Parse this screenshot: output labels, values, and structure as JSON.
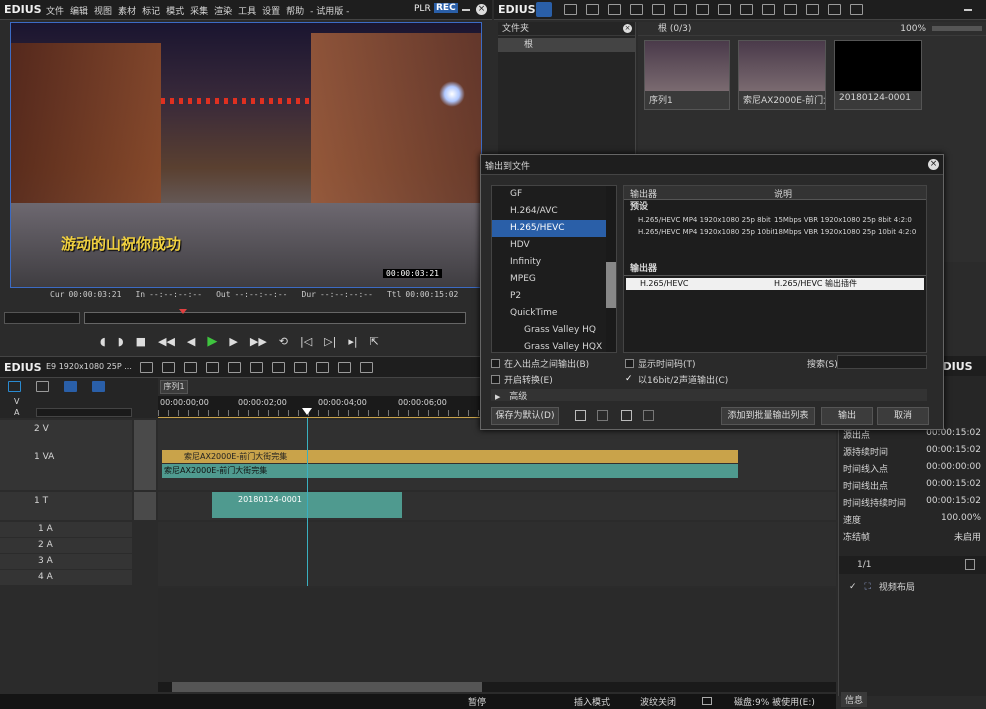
{
  "app": {
    "brand": "EDIUS",
    "menu": [
      "文件",
      "编辑",
      "视图",
      "素材",
      "标记",
      "模式",
      "采集",
      "渲染",
      "工具",
      "设置",
      "帮助"
    ],
    "trial": "- 试用版 -",
    "plr": "PLR",
    "rec": "REC"
  },
  "preview": {
    "subtitle": "游动的山祝你成功",
    "tc_overlay": "00:00:03:21",
    "cur_label": "Cur",
    "cur": "00:00:03:21",
    "in_label": "In",
    "in": "--:--:--:--",
    "out_label": "Out",
    "out": "--:--:--:--",
    "dur_label": "Dur",
    "dur": "--:--:--:--",
    "ttl_label": "Ttl",
    "ttl": "00:00:15:02"
  },
  "bin": {
    "brand": "EDIUS",
    "folder_header": "文件夹",
    "folder_root": "根",
    "path": "根 (0/3)",
    "zoom": "100%",
    "clips": [
      {
        "label": "序列1"
      },
      {
        "label": "索尼AX2000E-前门大街..."
      },
      {
        "label": "20180124-0001"
      }
    ]
  },
  "dialog": {
    "title": "输出到文件",
    "formats": [
      "GF",
      "H.264/AVC",
      "H.265/HEVC",
      "HDV",
      "Infinity",
      "MPEG",
      "P2",
      "QuickTime",
      "Grass Valley HQ",
      "Grass Valley HQX"
    ],
    "selected_format": "H.265/HEVC",
    "col_exporter": "输出器",
    "col_desc": "说明",
    "preset_header": "预设",
    "presets": [
      {
        "name": "H.265/HEVC MP4 1920x1080 25p 8bit",
        "desc": "15Mbps VBR 1920x1080 25p 8bit 4:2:0"
      },
      {
        "name": "H.265/HEVC MP4 1920x1080 25p 10bit",
        "desc": "18Mbps VBR 1920x1080 25p 10bit 4:2:0"
      }
    ],
    "exporter_header": "输出器",
    "exporter": {
      "name": "H.265/HEVC",
      "desc": "H.265/HEVC 输出插件"
    },
    "opt_inout": "在入出点之间输出(B)",
    "opt_show_tc": "显示时间码(T)",
    "opt_search": "搜索(S)",
    "opt_convert": "开启转换(E)",
    "opt_16bit": "以16bit/2声道输出(C)",
    "advanced": "高级",
    "btn_save_default": "保存为默认(D)",
    "btn_add_batch": "添加到批量输出列表",
    "btn_export": "输出",
    "btn_cancel": "取消"
  },
  "timeline": {
    "brand": "EDIUS",
    "project": "E9 1920x1080 25P ...",
    "sequence_tab": "序列1",
    "ruler": [
      "00:00:00;00",
      "00:00:02;00",
      "00:00:04;00",
      "00:00:06;00"
    ],
    "tracks": [
      {
        "label": "2 V"
      },
      {
        "label": "1 VA"
      },
      {
        "label": "1 T"
      },
      {
        "label": "1 A"
      },
      {
        "label": "2 A"
      },
      {
        "label": "3 A"
      },
      {
        "label": "4 A"
      }
    ],
    "clip_v": "索尼AX2000E-前门大街完集",
    "clip_a": "索尼AX2000E-前门大街完集",
    "clip_t": "20180124-0001"
  },
  "info": {
    "rows": [
      {
        "k": "源出点",
        "v": "00:00:15:02"
      },
      {
        "k": "源持续时间",
        "v": "00:00:15:02"
      },
      {
        "k": "时间线入点",
        "v": "00:00:00:00"
      },
      {
        "k": "时间线出点",
        "v": "00:00:15:02"
      },
      {
        "k": "时间线持续时间",
        "v": "00:00:15:02"
      },
      {
        "k": "速度",
        "v": "100.00%"
      },
      {
        "k": "冻结帧",
        "v": "未启用"
      }
    ],
    "page": "1/1",
    "effect": "视频布局",
    "tab": "信息"
  },
  "status": {
    "pause": "暂停",
    "insert": "插入模式",
    "ripple": "波纹关闭",
    "disk": "磁盘:9% 被使用(E:)"
  },
  "colors": {
    "accent": "#2a5fa8",
    "rec": "#c0392b",
    "clip_video": "#c9a34a",
    "clip_audio": "#4f9a8f"
  }
}
